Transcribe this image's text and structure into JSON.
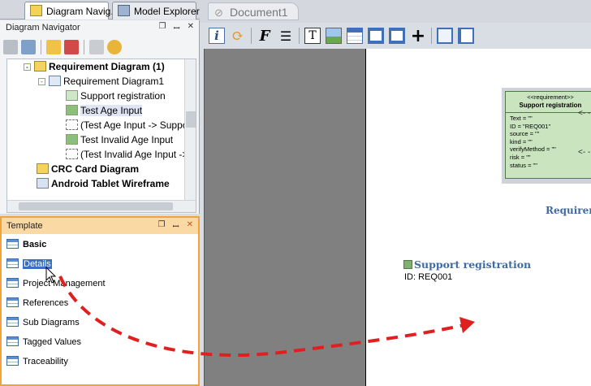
{
  "left_tabs": [
    {
      "label": "Diagram Navig...",
      "icon": "diagram-navigator-icon"
    },
    {
      "label": "Model Explorer",
      "icon": "model-explorer-icon"
    }
  ],
  "navigator": {
    "title": "Diagram Navigator",
    "tree": [
      {
        "label": "Requirement Diagram (1)",
        "bold": true,
        "icon": "folder-diagram-icon"
      },
      {
        "label": "Requirement Diagram1",
        "bold": false,
        "icon": "diagram-icon"
      },
      {
        "label": "Support registration",
        "bold": false,
        "icon": "requirement-icon"
      },
      {
        "label": "Test Age Input",
        "bold": false,
        "icon": "test-case-icon"
      },
      {
        "label": "(Test Age Input -> Suppor",
        "bold": false,
        "icon": "verify-link-icon"
      },
      {
        "label": "Test Invalid Age Input",
        "bold": false,
        "icon": "test-case-icon"
      },
      {
        "label": "(Test Invalid Age Input ->",
        "bold": false,
        "icon": "verify-link-icon"
      },
      {
        "label": "CRC Card Diagram",
        "bold": true,
        "icon": "crc-diagram-icon"
      },
      {
        "label": "Android Tablet Wireframe",
        "bold": true,
        "icon": "wireframe-icon"
      }
    ]
  },
  "template": {
    "title": "Template",
    "items": [
      {
        "label": "Basic",
        "bold": true
      },
      {
        "label": "Details",
        "bold": false,
        "selected": true
      },
      {
        "label": "Project Management",
        "bold": false
      },
      {
        "label": "References",
        "bold": false
      },
      {
        "label": "Sub Diagrams",
        "bold": false
      },
      {
        "label": "Tagged Values",
        "bold": false
      },
      {
        "label": "Traceability",
        "bold": false
      }
    ]
  },
  "document": {
    "tab_label": "Document1",
    "toolbar_icons": [
      "info-icon",
      "refresh-icon",
      "font-icon",
      "paragraph-icon",
      "text-box-icon",
      "image-icon",
      "table-icon",
      "page-break-icon",
      "page-break-alt-icon",
      "add-icon",
      "crop-icon",
      "page-setup-icon"
    ]
  },
  "canvas": {
    "requirement_box": {
      "stereotype": "<<requirement>>",
      "name": "Support registration",
      "attributes": [
        "Text = \"\"",
        "ID = \"REQ001\"",
        "source = \"\"",
        "kind = \"\"",
        "verifyMethod = \"\"",
        "risk = \"\"",
        "status = \"\""
      ]
    },
    "partial_heading": "Requiren",
    "section_heading": "Support registration",
    "section_id": "ID: REQ001"
  },
  "colors": {
    "accent_orange": "#f1a33a",
    "heading_blue": "#3e6aa4",
    "requirement_fill": "#c9e4bf",
    "drag_arrow_red": "#e02020"
  }
}
